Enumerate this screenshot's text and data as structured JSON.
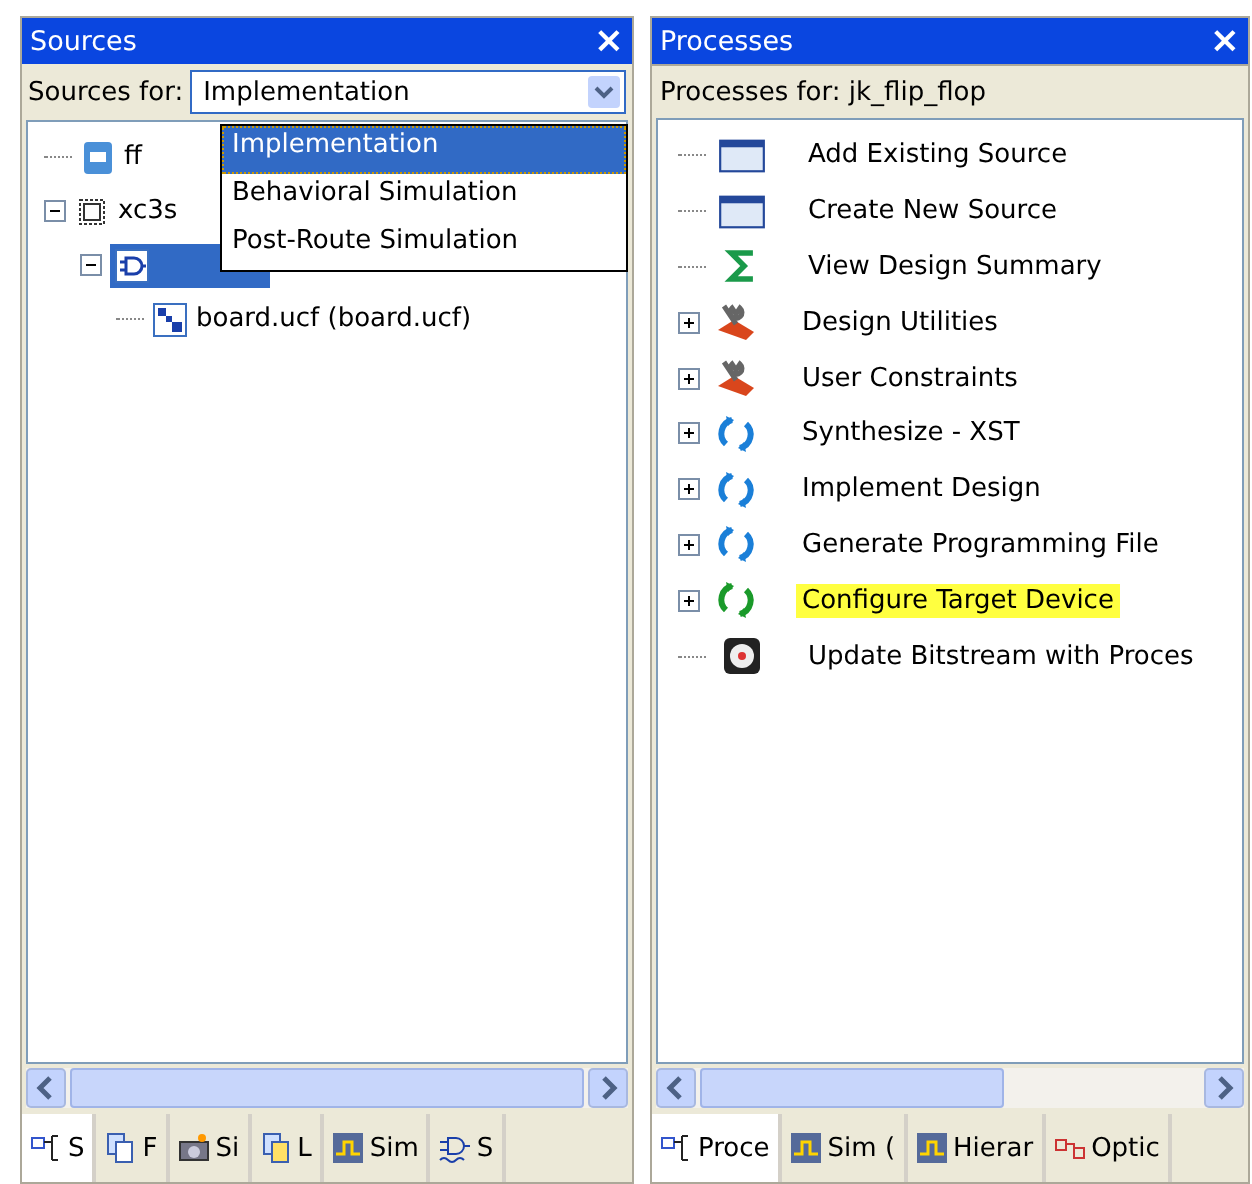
{
  "sources": {
    "title": "Sources",
    "close": "×",
    "sources_for_label": "Sources for:",
    "dropdown": {
      "value": "Implementation",
      "expanded": true,
      "options": [
        {
          "label": "Implementation",
          "selected": true
        },
        {
          "label": "Behavioral Simulation",
          "selected": false
        },
        {
          "label": "Post-Route Simulation",
          "selected": false
        }
      ]
    },
    "tree": [
      {
        "label": "ff",
        "kind": "file",
        "selected": false
      },
      {
        "label": "xc3s",
        "kind": "chip",
        "expanded": true,
        "selected": false,
        "children": [
          {
            "kind": "gate",
            "expanded": true,
            "selected": true,
            "children": [
              {
                "label": "board.ucf (board.ucf)",
                "kind": "ucf",
                "selected": false
              }
            ]
          }
        ]
      }
    ],
    "tabs": [
      {
        "label": "S",
        "kind": "hier",
        "selected": true
      },
      {
        "label": "F",
        "kind": "files",
        "selected": false
      },
      {
        "label": "Si",
        "kind": "camera",
        "selected": false
      },
      {
        "label": "L",
        "kind": "libs",
        "selected": false
      },
      {
        "label": "Sim",
        "kind": "wave",
        "selected": false
      },
      {
        "label": "S",
        "kind": "gatewave",
        "selected": false
      }
    ]
  },
  "processes": {
    "title": "Processes",
    "close": "×",
    "header": "Processes for: jk_flip_flop",
    "items": [
      {
        "label": "Add Existing Source",
        "kind": "window",
        "expandable": false,
        "highlighted": false
      },
      {
        "label": "Create New Source",
        "kind": "window",
        "expandable": false,
        "highlighted": false
      },
      {
        "label": "View Design Summary",
        "kind": "sigma",
        "expandable": false,
        "highlighted": false
      },
      {
        "label": "Design Utilities",
        "kind": "tools",
        "expandable": true,
        "highlighted": false
      },
      {
        "label": "User Constraints",
        "kind": "tools",
        "expandable": true,
        "highlighted": false
      },
      {
        "label": "Synthesize - XST",
        "kind": "run",
        "expandable": true,
        "highlighted": false
      },
      {
        "label": "Implement Design",
        "kind": "run",
        "expandable": true,
        "highlighted": false
      },
      {
        "label": "Generate Programming File",
        "kind": "run",
        "expandable": true,
        "highlighted": false
      },
      {
        "label": "Configure Target Device",
        "kind": "run-green",
        "expandable": true,
        "highlighted": true
      },
      {
        "label": "Update Bitstream with Proces",
        "kind": "bitstream",
        "expandable": false,
        "highlighted": false
      }
    ],
    "tabs": [
      {
        "label": "Proce",
        "kind": "proc",
        "selected": true
      },
      {
        "label": "Sim (",
        "kind": "wave",
        "selected": false
      },
      {
        "label": "Hierar",
        "kind": "wave",
        "selected": false
      },
      {
        "label": "Optic",
        "kind": "opt",
        "selected": false
      }
    ]
  }
}
